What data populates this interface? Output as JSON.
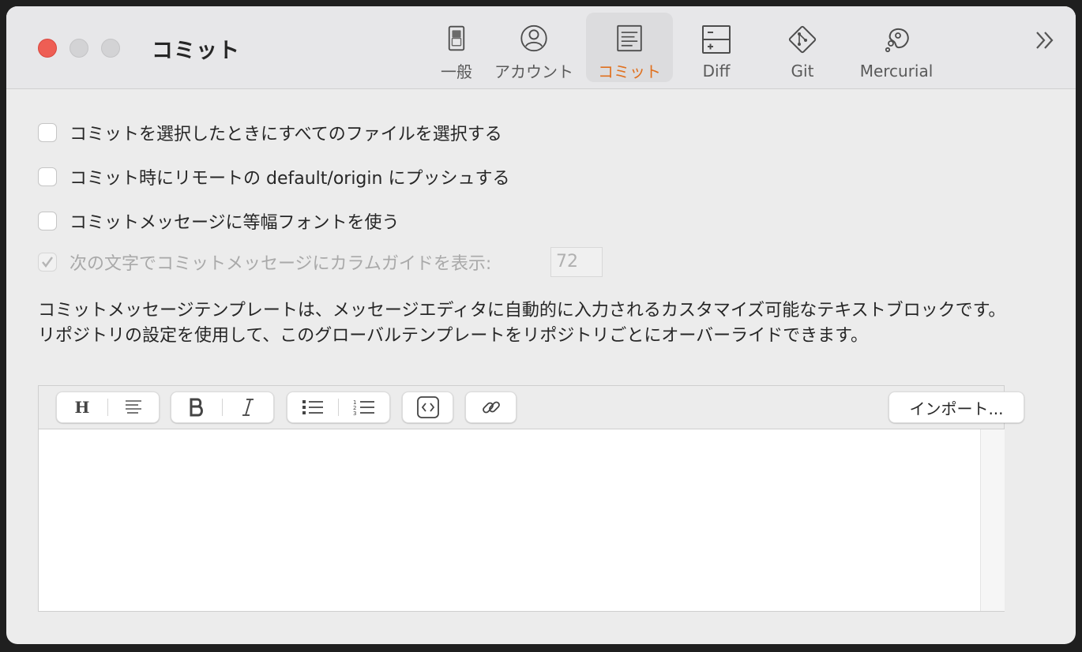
{
  "window": {
    "title": "コミット"
  },
  "toolbar_tabs": [
    {
      "label": "一般",
      "icon": "general-switch-icon",
      "active": false
    },
    {
      "label": "アカウント",
      "icon": "account-icon",
      "active": false
    },
    {
      "label": "コミット",
      "icon": "commit-document-icon",
      "active": true
    },
    {
      "label": "Diff",
      "icon": "diff-icon",
      "active": false
    },
    {
      "label": "Git",
      "icon": "git-icon",
      "active": false
    },
    {
      "label": "Mercurial",
      "icon": "mercurial-icon",
      "active": false
    }
  ],
  "options": [
    {
      "label": "コミットを選択したときにすべてのファイルを選択する",
      "checked": false,
      "enabled": true
    },
    {
      "label": "コミット時にリモートの default/origin にプッシュする",
      "checked": false,
      "enabled": true
    },
    {
      "label": "コミットメッセージに等幅フォントを使う",
      "checked": false,
      "enabled": true
    },
    {
      "label": "次の文字でコミットメッセージにカラムガイドを表示:",
      "checked": true,
      "enabled": false
    }
  ],
  "column_guide_value": "72",
  "description": "コミットメッセージテンプレートは、メッセージエディタに自動的に入力されるカスタマイズ可能なテキストブロックです。リポジトリの設定を使用して、このグローバルテンプレートをリポジトリごとにオーバーライドできます。",
  "editor": {
    "heading_label": "H",
    "import_label": "インポート...",
    "content": ""
  },
  "colors": {
    "accent": "#e0701e",
    "close": "#ee5e54"
  }
}
